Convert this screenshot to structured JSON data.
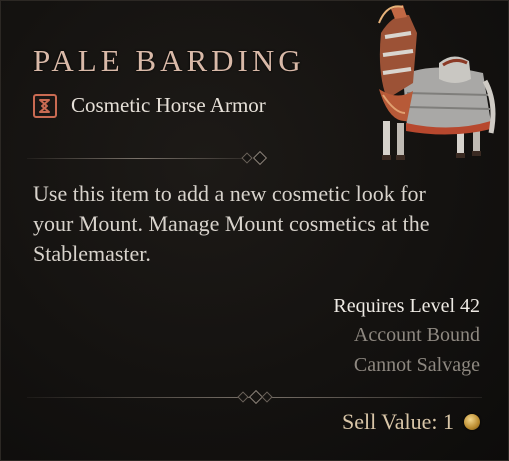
{
  "item": {
    "name": "PALE BARDING",
    "type": "Cosmetic Horse Armor",
    "type_icon": "horse-armor-rune-icon",
    "image": "armored-horse-icon",
    "description": "Use this item to add a new cosmetic look for your Mount. Manage Mount cosmetics at the Stablemaster.",
    "requirements": {
      "level": "Requires Level 42",
      "bound": "Account Bound",
      "salvage": "Cannot Salvage"
    },
    "sell": {
      "label": "Sell Value: 1",
      "currency_icon": "gold-coin-icon"
    }
  },
  "colors": {
    "name": "#d9b9a8",
    "icon_accent": "#c96a52",
    "body_text": "#d8d3cc",
    "muted_text": "#8e8880",
    "background": "#141210"
  }
}
